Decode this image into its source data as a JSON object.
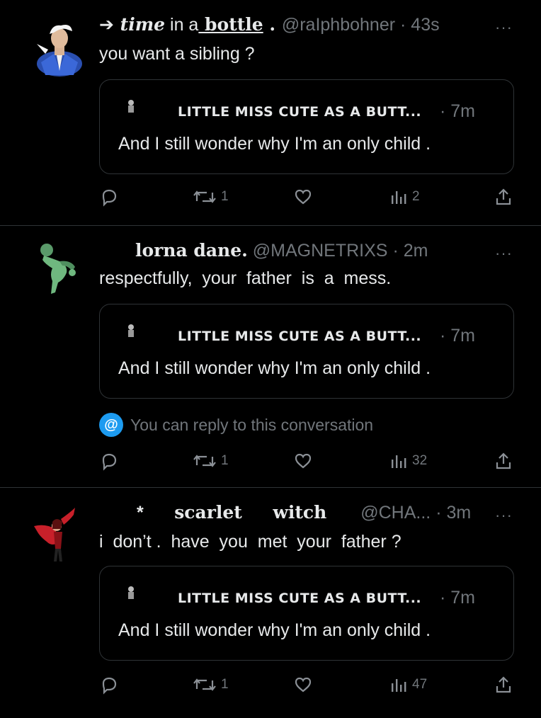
{
  "tweets": [
    {
      "avatar_icon": "hero-avatar-blue",
      "name_prefix": "➔",
      "name_part1": "time",
      "name_part2": " in a",
      "name_part3": " bottle",
      "name_part4": " .",
      "handle": "@raIphbohner",
      "time": "43s",
      "more": "···",
      "text": "you want a sibling ?",
      "quote": {
        "name": "LITTLE MISS CUTE AS A BUTT...",
        "time": "· 7m",
        "text": "And I still wonder why I'm an only child ."
      },
      "notice": "",
      "retweets": "1",
      "views": "2"
    },
    {
      "avatar_icon": "green-figure-avatar",
      "name": "lorna dane.",
      "handle": "@MAGNETRIXS",
      "time": "2m",
      "more": "···",
      "text": "respectfully,  your  father  is  a  mess.",
      "quote": {
        "name": "LITTLE MISS CUTE AS A BUTT...",
        "time": "· 7m",
        "text": "And I still wonder why I'm an only child ."
      },
      "notice": "You can reply to this conversation",
      "retweets": "1",
      "views": "32"
    },
    {
      "avatar_icon": "red-caped-figure-avatar",
      "name_prefix": "*",
      "name": "scarlet     witch",
      "handle": "@CHA...",
      "time": "3m",
      "more": "···",
      "text": "i  don’t .  have  you  met  your  father ?",
      "quote": {
        "name": "LITTLE MISS CUTE AS A BUTT...",
        "time": "· 7m",
        "text": "And I still wonder why I'm an only child ."
      },
      "notice": "",
      "retweets": "1",
      "views": "47"
    }
  ],
  "colors": {
    "background": "#000000",
    "text": "#e7e9ea",
    "muted": "#71767b",
    "border": "#2f3336",
    "accent": "#1d9bf0"
  }
}
